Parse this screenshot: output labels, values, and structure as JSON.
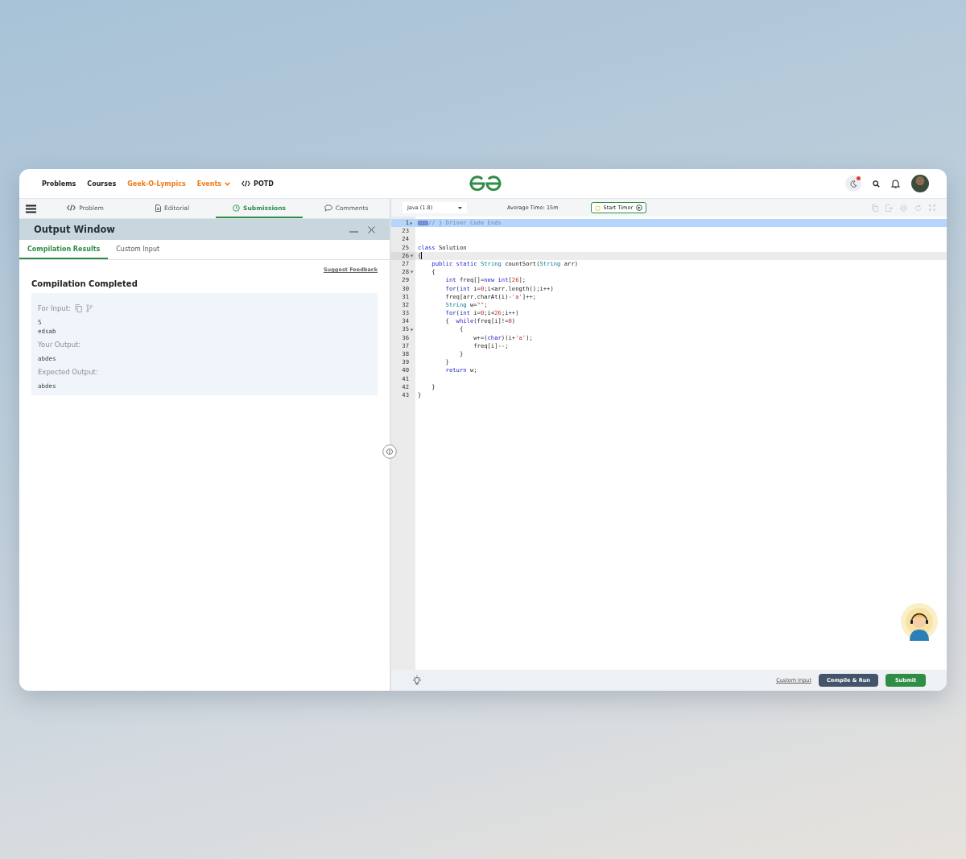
{
  "nav": {
    "links": [
      {
        "label": "Problems",
        "kind": "plain",
        "highlighted": false,
        "dropdown": false
      },
      {
        "label": "Courses",
        "kind": "plain",
        "highlighted": false,
        "dropdown": false
      },
      {
        "label": "Geek-O-Lympics",
        "kind": "plain",
        "highlighted": true,
        "dropdown": false
      },
      {
        "label": "Events",
        "kind": "plain",
        "highlighted": true,
        "dropdown": true
      },
      {
        "label": "POTD",
        "kind": "code",
        "highlighted": false,
        "dropdown": false
      }
    ],
    "notification_dot": true
  },
  "problem_tabs": [
    {
      "label": "Problem",
      "kind": "code",
      "selected": false
    },
    {
      "label": "Editorial",
      "kind": "document",
      "selected": false
    },
    {
      "label": "Submissions",
      "kind": "clock",
      "selected": true
    },
    {
      "label": "Comments",
      "kind": "chat",
      "selected": false
    }
  ],
  "output_window": {
    "title": "Output Window",
    "tabs": [
      {
        "label": "Compilation Results",
        "selected": true
      },
      {
        "label": "Custom Input",
        "selected": false
      }
    ],
    "feedback_link": "Suggest Feedback",
    "status": "Compilation Completed",
    "sections": [
      {
        "kind": "input",
        "label": "For Input:",
        "lines": [
          "5",
          "edsab"
        ]
      },
      {
        "kind": "output",
        "label": "Your Output:",
        "lines": [
          "abdes"
        ]
      },
      {
        "kind": "output",
        "label": "Expected Output:",
        "lines": [
          "abdes"
        ]
      }
    ]
  },
  "editor": {
    "language": "Java (1.8)",
    "average_time": "Average Time: 15m",
    "timer_button": "Start Timer",
    "lines": [
      {
        "number": "1",
        "kind": "collapsed",
        "selected": true,
        "current": false,
        "code": [
          {
            "text": "// } Driver Code Ends",
            "kind": "comment"
          }
        ]
      },
      {
        "number": "23",
        "kind": "plain",
        "selected": false,
        "current": false
      },
      {
        "number": "24",
        "kind": "plain",
        "selected": false,
        "current": false
      },
      {
        "number": "25",
        "kind": "plain",
        "selected": false,
        "current": false,
        "code": [
          {
            "text": "class",
            "kind": "keyword"
          },
          {
            "text": " Solution",
            "kind": "plain"
          }
        ]
      },
      {
        "number": "26",
        "kind": "expanded",
        "selected": false,
        "current": true,
        "code": [
          {
            "text": "{",
            "kind": "plain"
          }
        ]
      },
      {
        "number": "27",
        "kind": "plain",
        "selected": false,
        "current": false,
        "code": [
          {
            "text": "    public static",
            "kind": "keyword"
          },
          {
            "text": " String",
            "kind": "type"
          },
          {
            "text": " countSort(",
            "kind": "plain"
          },
          {
            "text": "String",
            "kind": "type"
          },
          {
            "text": " arr)",
            "kind": "plain"
          }
        ]
      },
      {
        "number": "28",
        "kind": "expanded",
        "selected": false,
        "current": false,
        "code": [
          {
            "text": "    {",
            "kind": "plain"
          }
        ]
      },
      {
        "number": "29",
        "kind": "plain",
        "selected": false,
        "current": false,
        "code": [
          {
            "text": "        int",
            "kind": "keyword"
          },
          {
            "text": " freq[]=",
            "kind": "plain"
          },
          {
            "text": "new",
            "kind": "keyword"
          },
          {
            "text": " int",
            "kind": "keyword"
          },
          {
            "text": "[",
            "kind": "plain"
          },
          {
            "text": "26",
            "kind": "number"
          },
          {
            "text": "];",
            "kind": "plain"
          }
        ]
      },
      {
        "number": "30",
        "kind": "plain",
        "selected": false,
        "current": false,
        "code": [
          {
            "text": "        for",
            "kind": "keyword"
          },
          {
            "text": "(",
            "kind": "plain"
          },
          {
            "text": "int",
            "kind": "keyword"
          },
          {
            "text": " i=",
            "kind": "plain"
          },
          {
            "text": "0",
            "kind": "number"
          },
          {
            "text": ";i<arr.length();i++)",
            "kind": "plain"
          }
        ]
      },
      {
        "number": "31",
        "kind": "plain",
        "selected": false,
        "current": false,
        "code": [
          {
            "text": "        freq[arr.charAt(i)-",
            "kind": "plain"
          },
          {
            "text": "'a'",
            "kind": "string"
          },
          {
            "text": "]++;",
            "kind": "plain"
          }
        ]
      },
      {
        "number": "32",
        "kind": "plain",
        "selected": false,
        "current": false,
        "code": [
          {
            "text": "        String",
            "kind": "type"
          },
          {
            "text": " w=",
            "kind": "plain"
          },
          {
            "text": "\"\"",
            "kind": "string"
          },
          {
            "text": ";",
            "kind": "plain"
          }
        ]
      },
      {
        "number": "33",
        "kind": "plain",
        "selected": false,
        "current": false,
        "code": [
          {
            "text": "        for",
            "kind": "keyword"
          },
          {
            "text": "(",
            "kind": "plain"
          },
          {
            "text": "int",
            "kind": "keyword"
          },
          {
            "text": " i=",
            "kind": "plain"
          },
          {
            "text": "0",
            "kind": "number"
          },
          {
            "text": ";i<",
            "kind": "plain"
          },
          {
            "text": "26",
            "kind": "number"
          },
          {
            "text": ";i++)",
            "kind": "plain"
          }
        ]
      },
      {
        "number": "34",
        "kind": "plain",
        "selected": false,
        "current": false,
        "code": [
          {
            "text": "        {  ",
            "kind": "plain"
          },
          {
            "text": "while",
            "kind": "keyword"
          },
          {
            "text": "(freq[i]!=",
            "kind": "plain"
          },
          {
            "text": "0",
            "kind": "number"
          },
          {
            "text": ")",
            "kind": "plain"
          }
        ]
      },
      {
        "number": "35",
        "kind": "expanded",
        "selected": false,
        "current": false,
        "code": [
          {
            "text": "            {",
            "kind": "plain"
          }
        ]
      },
      {
        "number": "36",
        "kind": "plain",
        "selected": false,
        "current": false,
        "code": [
          {
            "text": "                w+=(",
            "kind": "plain"
          },
          {
            "text": "char",
            "kind": "keyword"
          },
          {
            "text": ")(i+",
            "kind": "plain"
          },
          {
            "text": "'a'",
            "kind": "string"
          },
          {
            "text": ");",
            "kind": "plain"
          }
        ]
      },
      {
        "number": "37",
        "kind": "plain",
        "selected": false,
        "current": false,
        "code": [
          {
            "text": "                freq[i]--;",
            "kind": "plain"
          }
        ]
      },
      {
        "number": "38",
        "kind": "plain",
        "selected": false,
        "current": false,
        "code": [
          {
            "text": "            }",
            "kind": "plain"
          }
        ]
      },
      {
        "number": "39",
        "kind": "plain",
        "selected": false,
        "current": false,
        "code": [
          {
            "text": "        }",
            "kind": "plain"
          }
        ]
      },
      {
        "number": "40",
        "kind": "plain",
        "selected": false,
        "current": false,
        "code": [
          {
            "text": "        return",
            "kind": "keyword"
          },
          {
            "text": " w;",
            "kind": "plain"
          }
        ]
      },
      {
        "number": "41",
        "kind": "plain",
        "selected": false,
        "current": false
      },
      {
        "number": "42",
        "kind": "plain",
        "selected": false,
        "current": false,
        "code": [
          {
            "text": "    }",
            "kind": "plain"
          }
        ]
      },
      {
        "number": "43",
        "kind": "plain",
        "selected": false,
        "current": false,
        "code": [
          {
            "text": "}",
            "kind": "plain"
          }
        ]
      }
    ]
  },
  "footer": {
    "custom_input": "Custom Input",
    "compile_button": "Compile & Run",
    "submit_button": "Submit"
  }
}
